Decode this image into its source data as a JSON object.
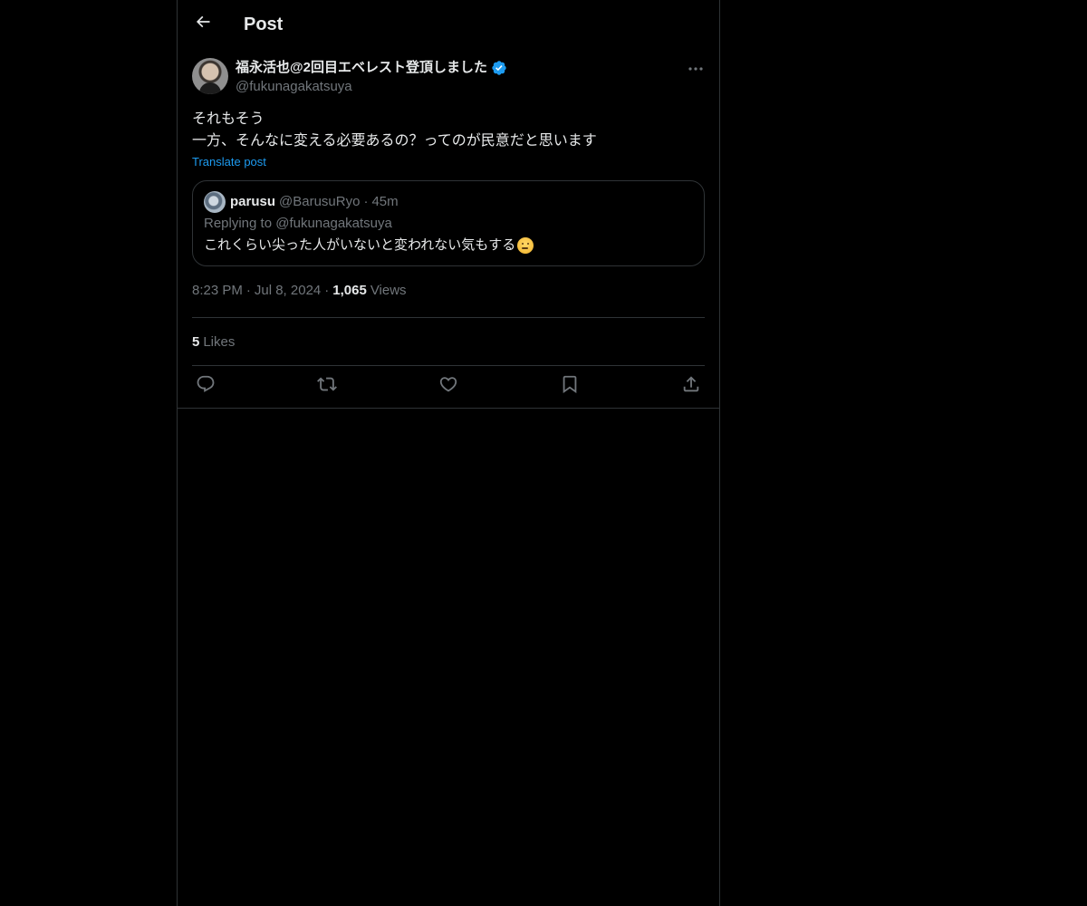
{
  "header": {
    "title": "Post"
  },
  "post": {
    "author_name": "福永活也@2回目エベレスト登頂しました",
    "author_handle": "@fukunagakatsuya",
    "verified": true,
    "text_lines": [
      "それもそう",
      "一方、そんなに変える必要あるの？ってのが民意だと思います"
    ],
    "translate_label": "Translate post",
    "time": "8:23 PM",
    "date": "Jul 8, 2024",
    "views_count": "1,065",
    "views_label": "Views",
    "likes_count": "5",
    "likes_label": "Likes",
    "separator": "·"
  },
  "quoted": {
    "name": "parusu",
    "handle": "@BarusuRyo",
    "time": "45m",
    "replying_to": "Replying to @fukunagakatsuya",
    "text": "これくらい尖った人がいないと変われない気もする",
    "emoji": "thinking-face-emoji"
  },
  "icons": {
    "back": "back-arrow-icon",
    "more": "more-dots-icon",
    "verified": "verified-badge-icon",
    "reply": "reply-icon",
    "repost": "repost-icon",
    "like": "like-icon",
    "bookmark": "bookmark-icon",
    "share": "share-icon"
  },
  "colors": {
    "background": "#000000",
    "text_primary": "#e7e9ea",
    "text_secondary": "#71767b",
    "accent": "#1d9bf0",
    "border": "#2f3336"
  }
}
